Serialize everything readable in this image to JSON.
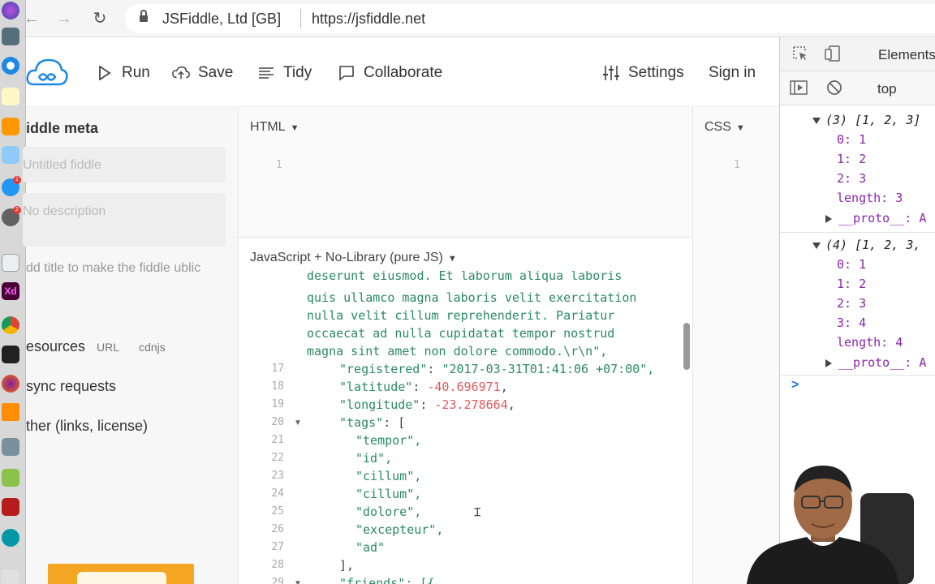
{
  "browser": {
    "owner": "JSFiddle, Ltd [GB]",
    "url": "https://jsfiddle.net"
  },
  "header": {
    "run": "Run",
    "save": "Save",
    "tidy": "Tidy",
    "collaborate": "Collaborate",
    "settings": "Settings",
    "signin": "Sign in"
  },
  "sidebar": {
    "title": "iddle meta",
    "title_placeholder": "Untitled fiddle",
    "desc_placeholder": "No description",
    "hint": "dd title to make the fiddle ublic",
    "resources": "esources",
    "resources_url": "URL",
    "resources_cdnjs": "cdnjs",
    "async": "sync requests",
    "other": "ther (links, license)"
  },
  "panes": {
    "html_label": "HTML",
    "html_line": "1",
    "css_label": "CSS",
    "css_line": "1",
    "js_label": "JavaScript + No-Library (pure JS)"
  },
  "code": {
    "partial_top": "deserunt eiusmod. Et laborum aliqua laboris",
    "lines_plain": [
      "quis ullamco magna laboris velit exercitation",
      "nulla velit cillum reprehenderit. Pariatur",
      "occaecat ad nulla cupidatat tempor nostrud",
      "magna sint amet non dolore commodo.\\r\\n\","
    ],
    "registered_key": "\"registered\"",
    "registered_val": "\"2017-03-31T01:41:06 +07:00\",",
    "latitude_key": "\"latitude\"",
    "latitude_val": "-40.696971",
    "longitude_key": "\"longitude\"",
    "longitude_val": "-23.278664",
    "tags_key": "\"tags\"",
    "tags": [
      "\"tempor\",",
      "\"id\",",
      "\"cillum\",",
      "\"cillum\",",
      "\"dolore\",",
      "\"excepteur\",",
      "\"ad\""
    ],
    "close_bracket": "],",
    "friends_key": "\"friends\": [{",
    "gutter": [
      "17",
      "18",
      "19",
      "20",
      "21",
      "22",
      "23",
      "24",
      "25",
      "26",
      "27",
      "28",
      "29"
    ]
  },
  "devtools": {
    "tab_elements": "Elements",
    "context": "top",
    "arr3_header": "(3) [1, 2, 3]",
    "arr3_items": [
      "0: 1",
      "1: 2",
      "2: 3"
    ],
    "arr3_length": "length: 3",
    "proto": "__proto__: A",
    "arr4_header": "(4) [1, 2, 3,",
    "arr4_items": [
      "0: 1",
      "1: 2",
      "2: 3",
      "3: 4"
    ],
    "arr4_length": "length: 4",
    "prompt": ">"
  },
  "colors": {
    "string_green": "#2a8a64",
    "number_red": "#e2595b",
    "logo_blue": "#1e88e5"
  }
}
